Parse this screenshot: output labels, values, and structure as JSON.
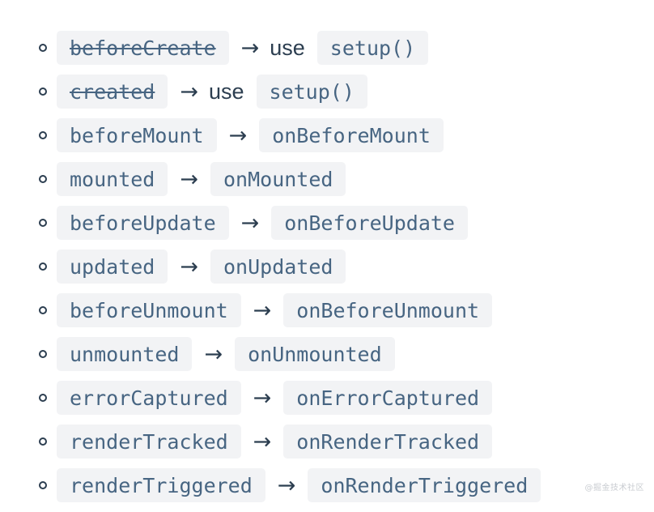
{
  "page": {
    "background_color": "#ffffff",
    "code_chip_bg": "#f2f3f5",
    "code_text_color": "#476582",
    "plain_text_color": "#2c3e50",
    "bullet_glyph": "○",
    "arrow_glyph": "→"
  },
  "watermark": {
    "text": "@掘金技术社区"
  },
  "list": {
    "items": [
      {
        "old_hook": "beforeCreate",
        "struck": true,
        "connector": "→",
        "note": "use",
        "new_hook": "setup()"
      },
      {
        "old_hook": "created",
        "struck": true,
        "connector": "→",
        "note": "use",
        "new_hook": "setup()"
      },
      {
        "old_hook": "beforeMount",
        "struck": false,
        "connector": "→",
        "note": "",
        "new_hook": "onBeforeMount"
      },
      {
        "old_hook": "mounted",
        "struck": false,
        "connector": "→",
        "note": "",
        "new_hook": "onMounted"
      },
      {
        "old_hook": "beforeUpdate",
        "struck": false,
        "connector": "→",
        "note": "",
        "new_hook": "onBeforeUpdate"
      },
      {
        "old_hook": "updated",
        "struck": false,
        "connector": "→",
        "note": "",
        "new_hook": "onUpdated"
      },
      {
        "old_hook": "beforeUnmount",
        "struck": false,
        "connector": "→",
        "note": "",
        "new_hook": "onBeforeUnmount"
      },
      {
        "old_hook": "unmounted",
        "struck": false,
        "connector": "→",
        "note": "",
        "new_hook": "onUnmounted"
      },
      {
        "old_hook": "errorCaptured",
        "struck": false,
        "connector": "→",
        "note": "",
        "new_hook": "onErrorCaptured"
      },
      {
        "old_hook": "renderTracked",
        "struck": false,
        "connector": "→",
        "note": "",
        "new_hook": "onRenderTracked"
      },
      {
        "old_hook": "renderTriggered",
        "struck": false,
        "connector": "→",
        "note": "",
        "new_hook": "onRenderTriggered"
      }
    ]
  }
}
